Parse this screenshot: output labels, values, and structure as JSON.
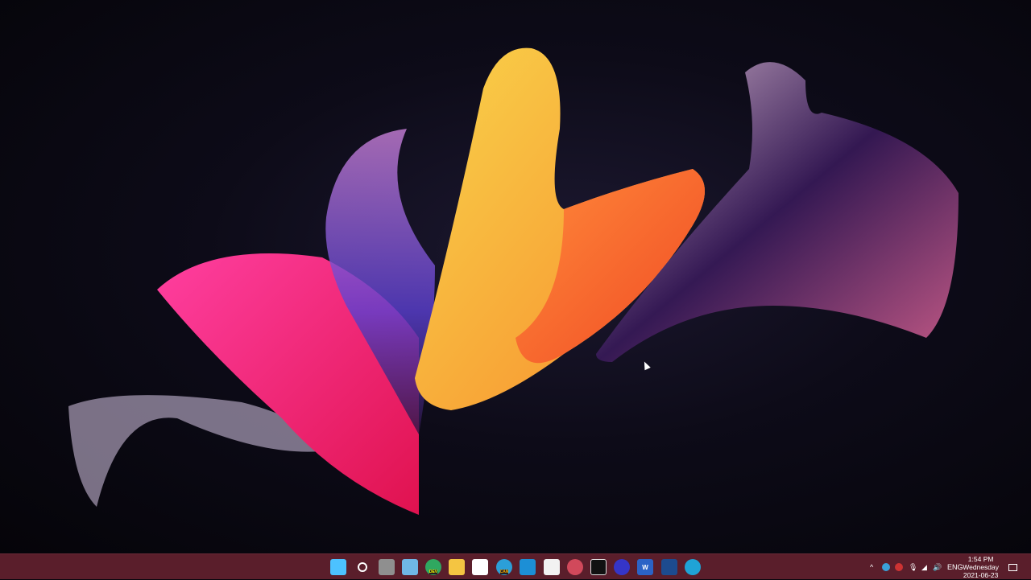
{
  "taskbar": {
    "color": "#5a1e2b",
    "icons": [
      {
        "name": "start-icon",
        "color": "#4cc2ff"
      },
      {
        "name": "search-icon",
        "color": "#ffffff"
      },
      {
        "name": "task-view-icon",
        "color": "#cfcfcf"
      },
      {
        "name": "widgets-icon",
        "color": "#6fb7e6"
      },
      {
        "name": "edge-dev-icon",
        "color": "#2fa860",
        "badge": "DEV"
      },
      {
        "name": "file-explorer-icon",
        "color": "#f4c542"
      },
      {
        "name": "store-icon",
        "color": "#ffffff"
      },
      {
        "name": "edge-canary-icon",
        "color": "#2b9fd8",
        "badge": "CAN"
      },
      {
        "name": "mail-icon",
        "color": "#1c8fd6"
      },
      {
        "name": "app-icon",
        "color": "#f2f2f2"
      },
      {
        "name": "podcast-app-icon",
        "color": "#d1495b"
      },
      {
        "name": "terminal-app-icon",
        "color": "#111111"
      },
      {
        "name": "media-app-icon",
        "color": "#3535c8"
      },
      {
        "name": "word-icon",
        "color": "#2b63c6"
      },
      {
        "name": "window-app-icon",
        "color": "#1d4b8f"
      },
      {
        "name": "edge-icon",
        "color": "#1fa3d6"
      }
    ],
    "tray": {
      "language": "ENG",
      "time": "1:54 PM",
      "day": "Wednesday",
      "date": "2021-06-23"
    }
  }
}
